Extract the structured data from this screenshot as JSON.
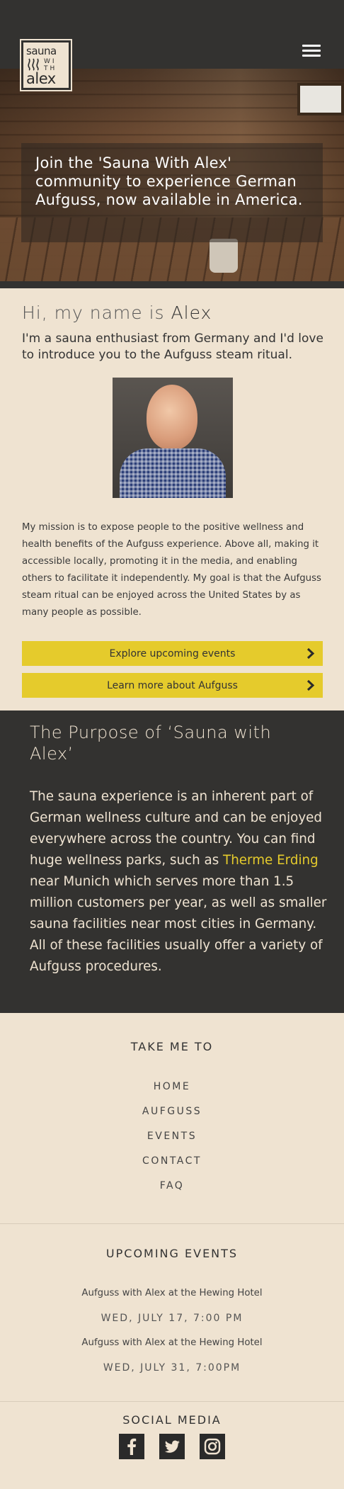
{
  "logo": {
    "line1": "sauna",
    "line2": "WI TH",
    "line3": "alex"
  },
  "header": {
    "menu_icon": "hamburger-menu-icon"
  },
  "hero": {
    "headline": "Join the 'Sauna With Alex' community to experience German Aufguss, now available in America."
  },
  "intro": {
    "greeting": "Hi, my name is",
    "name": "Alex",
    "subtitle": "I'm a sauna enthusiast from Germany and I'd love to introduce you to the Aufguss steam ritual.",
    "mission": "My mission is to expose people to the positive wellness and health benefits of the Aufguss experience. Above all, making it accessible locally, promoting it in the media, and enabling others to facilitate it independently. My goal is that the Aufguss steam ritual can be enjoyed across the United States by as many people as possible."
  },
  "buttons": {
    "explore_events": "Explore upcoming events",
    "learn_aufguss": "Learn more about Aufguss",
    "chevron_icon": "chevron-right-icon"
  },
  "purpose": {
    "title": "The Purpose of ‘Sauna with Alex’",
    "text_before": "The sauna experience is an inherent part of German wellness culture and can be enjoyed everywhere across the country. You can find huge wellness parks, such as ",
    "link_text": "Therme Erding",
    "text_after": " near Munich which serves more than 1.5 million customers per year, as well as smaller sauna facilities near most cities in Germany. All of these facilities usually offer a variety of Aufguss procedures.",
    "link_color": "#e5cb2c"
  },
  "footer_nav": {
    "title": "TAKE ME TO",
    "links": [
      "HOME",
      "AUFGUSS",
      "EVENTS",
      "CONTACT",
      "FAQ"
    ]
  },
  "events": {
    "title": "UPCOMING EVENTS",
    "items": [
      {
        "name": "Aufguss with Alex at the Hewing Hotel",
        "date": "WED, JULY 17, 7:00 PM"
      },
      {
        "name": "Aufguss with Alex at the Hewing Hotel",
        "date": "WED, JULY 31, 7:00PM"
      }
    ]
  },
  "social": {
    "title": "SOCIAL MEDIA",
    "icons": [
      "facebook-icon",
      "twitter-icon",
      "instagram-icon"
    ]
  },
  "colors": {
    "background": "#efe3d1",
    "dark": "#333230",
    "accent": "#e5cb2c"
  }
}
